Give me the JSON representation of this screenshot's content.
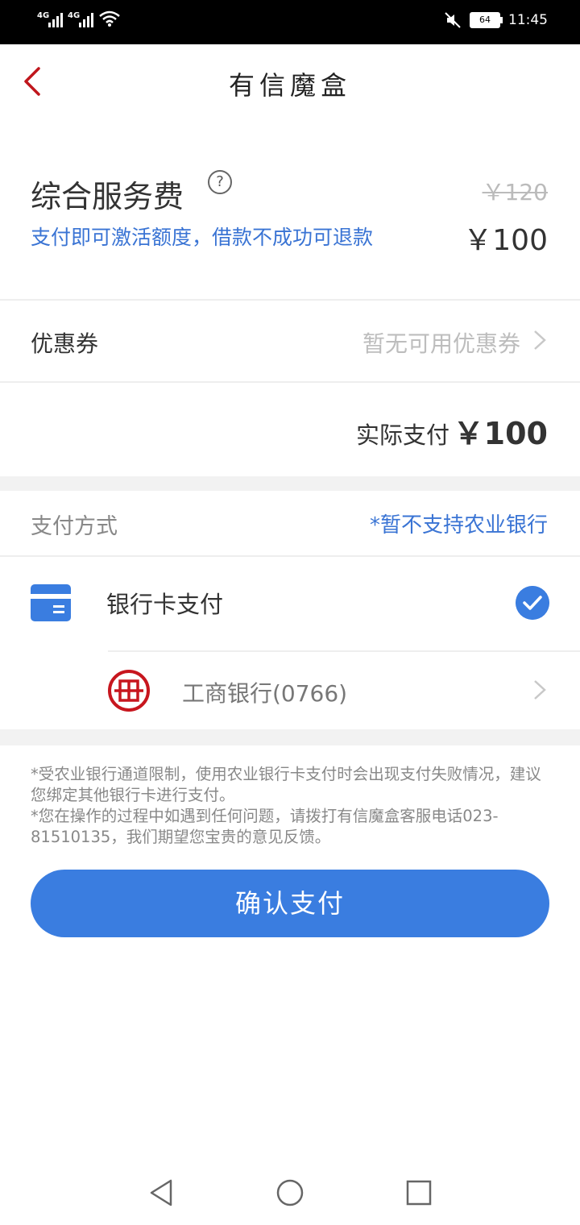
{
  "status_bar": {
    "signal_1_label": "4G",
    "signal_2_label": "4G",
    "battery_level": "64",
    "time": "11:45",
    "icons": [
      "signal-icon",
      "wifi-icon",
      "mute-icon",
      "battery-icon"
    ]
  },
  "header": {
    "title": "有信魔盒",
    "back_icon": "chevron-left-icon"
  },
  "fee": {
    "title": "综合服务费",
    "help_glyph": "?",
    "subtitle": "支付即可激活额度，借款不成功可退款",
    "original_price": "￥120",
    "price": "￥100"
  },
  "coupon": {
    "label": "优惠券",
    "value": "暂无可用优惠券"
  },
  "actual_payment": {
    "label": "实际支付",
    "value": "￥100"
  },
  "payment_method": {
    "label": "支付方式",
    "notice": "*暂不支持农业银行",
    "option_label": "银行卡支付",
    "bank": "工商银行(0766)"
  },
  "notes": [
    "*受农业银行通道限制，使用农业银行卡支付时会出现支付失败情况，建议您绑定其他银行卡进行支付。",
    "*您在操作的过程中如遇到任何问题，请拨打有信魔盒客服电话023-81510135，我们期望您宝贵的意见反馈。"
  ],
  "confirm_button": "确认支付",
  "colors": {
    "accent": "#3a7de0",
    "link_blue": "#3a74d4",
    "back_red": "#c0161c",
    "bank_red": "#c7161e"
  }
}
